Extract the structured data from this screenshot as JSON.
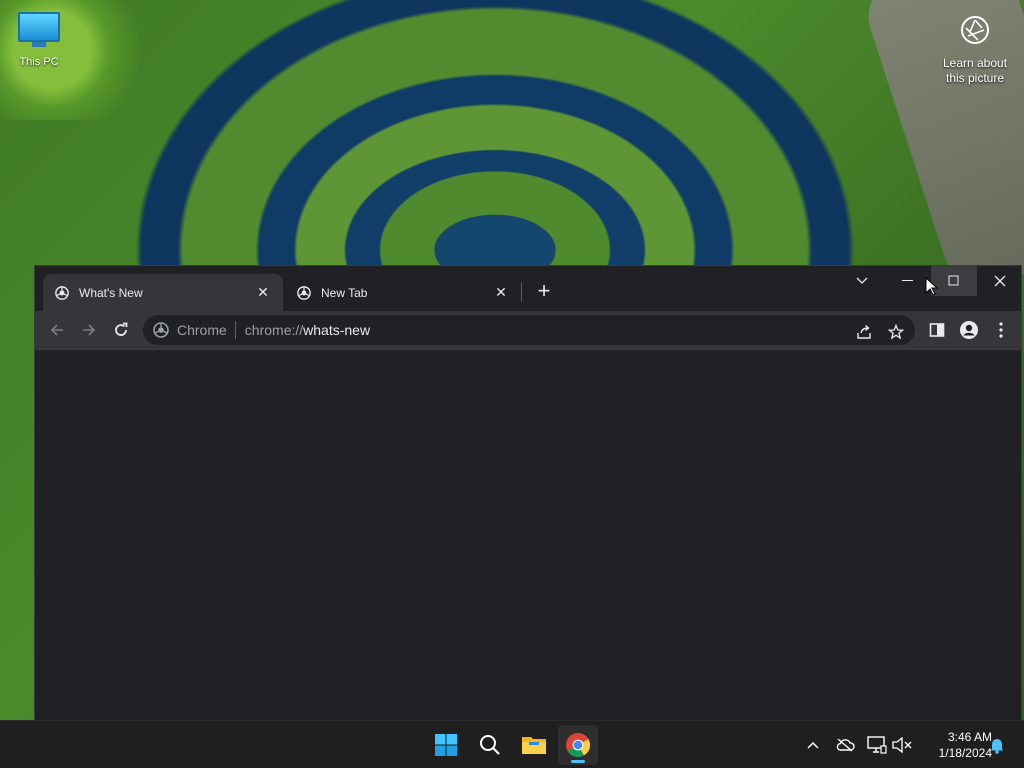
{
  "desktop": {
    "icons": [
      {
        "label": "This PC"
      },
      {
        "label": "Learn about this picture"
      }
    ]
  },
  "chrome": {
    "tabs": [
      {
        "title": "What's New",
        "active": true
      },
      {
        "title": "New Tab",
        "active": false
      }
    ],
    "omnibox": {
      "chip": "Chrome",
      "url_prefix": "chrome://",
      "url_host": "whats-new"
    }
  },
  "taskbar": {
    "apps": [
      "start-icon",
      "search-icon",
      "file-explorer-icon",
      "chrome-icon"
    ],
    "clock": {
      "time": "3:46 AM",
      "date": "1/18/2024"
    }
  },
  "colors": {
    "chrome_bg": "#202124",
    "toolbar_bg": "#35363a",
    "taskbar_bg": "#1f1f1f",
    "accent": "#4cc2ff"
  }
}
